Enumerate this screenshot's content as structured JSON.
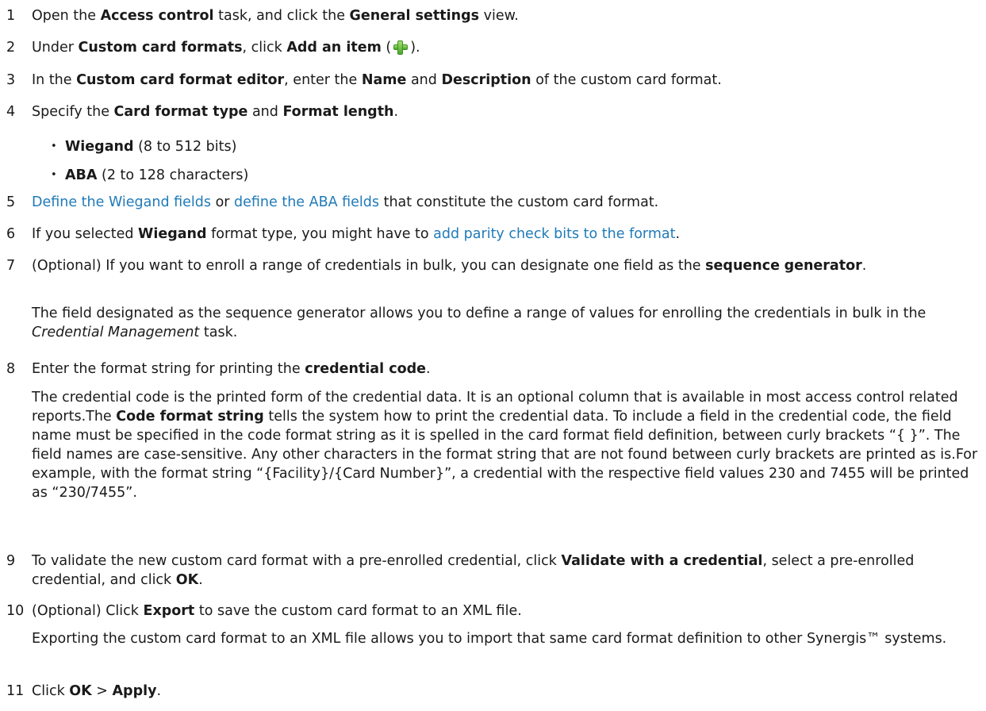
{
  "steps": [
    {
      "num": "1",
      "parts": [
        "Open the ",
        "Access control",
        " task, and click the ",
        "General settings",
        " view."
      ]
    },
    {
      "num": "2",
      "parts": [
        "Under ",
        "Custom card formats",
        ", click ",
        "Add an item",
        " (",
        ")."
      ],
      "icon": "plus-icon"
    },
    {
      "num": "3",
      "parts": [
        "In the ",
        "Custom card format editor",
        ", enter the ",
        "Name",
        " and ",
        "Description",
        " of the custom card format."
      ]
    },
    {
      "num": "4",
      "parts": [
        "Specify the ",
        "Card format type",
        " and ",
        "Format length",
        "."
      ],
      "bullets": [
        {
          "bold": "Wiegand",
          "rest": " (8 to 512 bits)"
        },
        {
          "bold": "ABA",
          "rest": " (2 to 128 characters)"
        }
      ]
    },
    {
      "num": "5",
      "link1": "Define the Wiegand fields",
      "mid": " or ",
      "link2": "define the ABA fields",
      "rest": " that constitute the custom card format."
    },
    {
      "num": "6",
      "pre": "If you selected ",
      "bold": "Wiegand",
      "mid": " format type, you might have to ",
      "link": "add parity check bits to the format",
      "end": "."
    },
    {
      "num": "7",
      "pre": "(Optional) If you want to enroll a range of credentials in bulk, you can designate one field as the ",
      "bold1": "sequence",
      "bold2": "generator",
      "end": ".",
      "para": {
        "pre": "The field designated as the sequence generator allows you to define a range of values for enrolling the credentials in bulk in the ",
        "italic": "Credential Management",
        "end": " task."
      }
    },
    {
      "num": "8",
      "pre": "Enter the format string for printing the ",
      "bold": "credential code",
      "end": ".",
      "para": {
        "pre": "The credential code is the printed form of the credential data. It is an optional column that is available in most access control related reports.The ",
        "bold": "Code format string",
        "end": " tells the system how to print the credential data. To include a field in the credential code, the field name must be specified in the code format string as it is spelled in the card format field definition, between curly brackets “{ }”. The field names are case-sensitive. Any other characters in the format string that are not found between curly brackets are printed as is.For example, with the format string “{Facility}/{Card Number}”, a credential with the respective field values 230 and 7455 will be printed as “230/7455”."
      }
    },
    {
      "num": "9",
      "pre": "To validate the new custom card format with a pre-enrolled credential, click ",
      "bold1": "Validate with a credential",
      "mid": ", select a pre-enrolled credential, and click ",
      "bold2": "OK",
      "end": "."
    },
    {
      "num": "10",
      "pre": "(Optional) Click ",
      "bold": "Export",
      "end": " to save the custom card format to an XML file.",
      "para": {
        "text": "Exporting the custom card format to an XML file allows you to import that same card format definition to other Synergis™ systems."
      }
    },
    {
      "num": "11",
      "pre": "Click ",
      "bold1": "OK",
      "mid": " > ",
      "bold2": "Apply",
      "end": "."
    }
  ]
}
